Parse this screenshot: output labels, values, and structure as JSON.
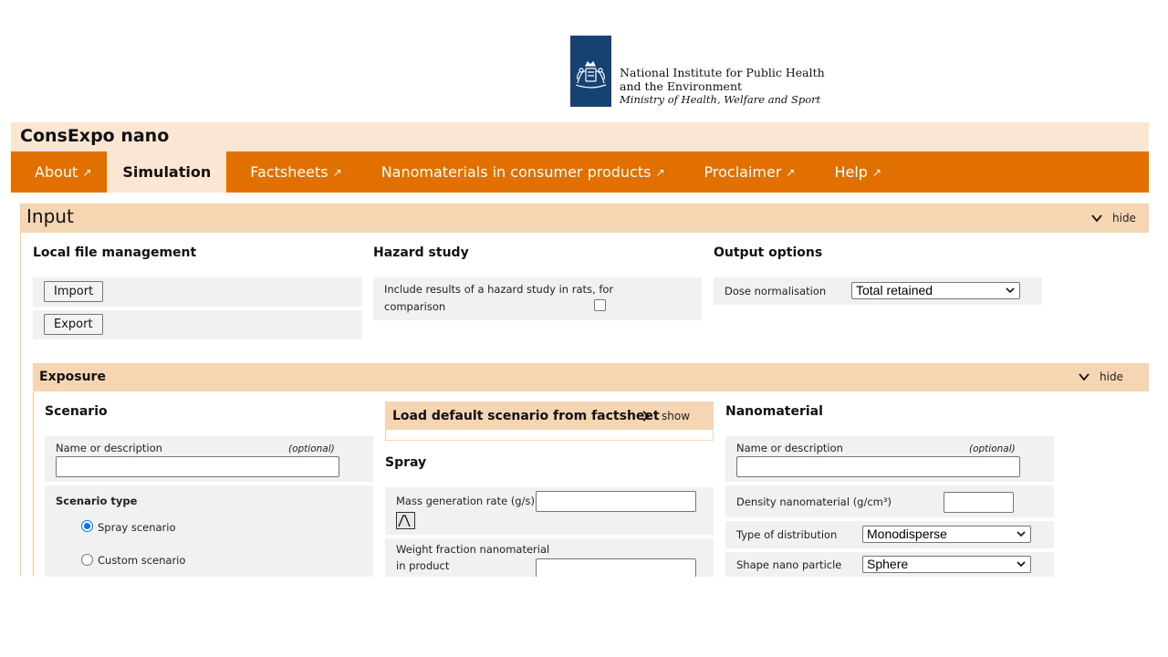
{
  "logo": {
    "line1": "National Institute for Public Health",
    "line2": "and the Environment",
    "line3": "Ministry of Health, Welfare and Sport",
    "block_color": "#154273"
  },
  "app": {
    "title": "ConsExpo nano"
  },
  "nav": {
    "items": [
      {
        "label": "About",
        "arrow": "↗"
      },
      {
        "label": "Simulation",
        "arrow": ""
      },
      {
        "label": "Factsheets",
        "arrow": "↗"
      },
      {
        "label": "Nanomaterials in consumer products",
        "arrow": "↗"
      },
      {
        "label": "Proclaimer",
        "arrow": "↗"
      },
      {
        "label": "Help",
        "arrow": "↗"
      }
    ],
    "active": "Simulation",
    "color": "#e17000"
  },
  "input": {
    "title": "Input",
    "toggle_label": "hide",
    "local_file": {
      "title": "Local file management",
      "import_label": "Import",
      "export_label": "Export"
    },
    "hazard": {
      "title": "Hazard study",
      "checkbox_label_line1": "Include results of a hazard study in rats, for",
      "checkbox_label_line2": "comparison",
      "checked": false
    },
    "output": {
      "title": "Output options",
      "dose_label": "Dose normalisation",
      "dose_value": "Total retained"
    }
  },
  "exposure": {
    "title": "Exposure",
    "toggle_label": "hide",
    "scenario": {
      "title": "Scenario",
      "name_label": "Name or description",
      "optional_label": "(optional)",
      "name_value": "",
      "type_title": "Scenario type",
      "options": [
        {
          "label": "Spray scenario",
          "checked": true
        },
        {
          "label": "Custom scenario",
          "checked": false
        }
      ]
    },
    "load_default": {
      "title": "Load default scenario from factsheet",
      "toggle_label": "show"
    },
    "spray": {
      "title": "Spray",
      "mass_rate_label": "Mass generation rate (g/s)",
      "mass_rate_value": "",
      "weight_fraction_line1": "Weight fraction nanomaterial",
      "weight_fraction_line2": "in product",
      "weight_fraction_value": ""
    },
    "nanomaterial": {
      "title": "Nanomaterial",
      "name_label": "Name or description",
      "optional_label": "(optional)",
      "name_value": "",
      "density_label": "Density nanomaterial (g/cm³)",
      "density_value": "",
      "distribution_label": "Type of distribution",
      "distribution_value": "Monodisperse",
      "shape_label": "Shape nano particle",
      "shape_value": "Sphere"
    }
  }
}
